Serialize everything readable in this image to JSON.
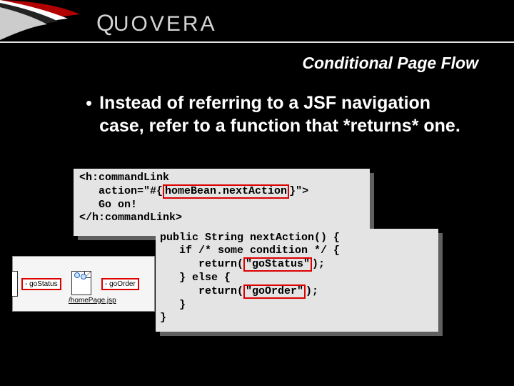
{
  "logo": {
    "brand_first": "Q",
    "brand_rest": "UOVERA"
  },
  "slide_title": "Conditional Page Flow",
  "bullet": {
    "text": "Instead of referring to a JSF navigation case, refer to a function that *returns* one."
  },
  "code1": {
    "l1": "<h:commandLink",
    "l2_pre": "   action=\"#{",
    "l2_hl": "homeBean.nextAction",
    "l2_post": "}\">",
    "l3": "   Go on!",
    "l4": "</h:commandLink>"
  },
  "code2": {
    "l1": "public String nextAction() {",
    "l2": "   if /* some condition */ {",
    "l3_pre": "      return(",
    "l3_hl": "\"goStatus\"",
    "l3_post": ");",
    "l4": "   } else {",
    "l5_pre": "      return(",
    "l5_hl": "\"goOrder\"",
    "l5_post": ");",
    "l6": "   }",
    "l7": "}"
  },
  "diagram": {
    "label1": "- goStatus",
    "label2": "- goOrder",
    "caption": "/homePage.jsp"
  }
}
